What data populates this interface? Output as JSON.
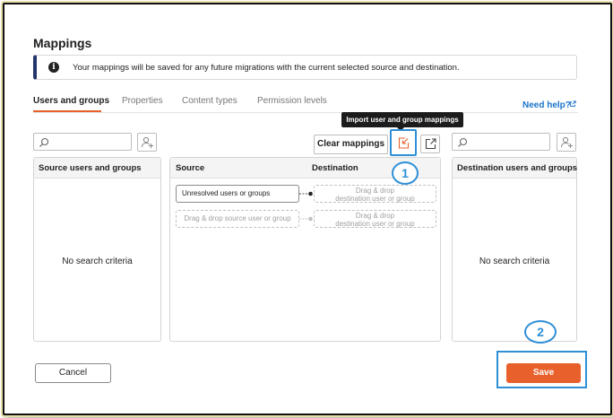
{
  "dialog": {
    "title": "Mappings",
    "info_text": "Your mappings will be saved for any future migrations with the current selected source and destination."
  },
  "tabs": [
    {
      "label": "Users and groups",
      "active": true
    },
    {
      "label": "Properties",
      "active": false
    },
    {
      "label": "Content types",
      "active": false
    },
    {
      "label": "Permission levels",
      "active": false
    }
  ],
  "help_link": "Need help?",
  "toolbar": {
    "clear_mappings_label": "Clear mappings",
    "import_tooltip": "Import user and group mappings"
  },
  "source_panel": {
    "title": "Source users and groups",
    "empty_text": "No search criteria"
  },
  "mapping_panel": {
    "source_header": "Source",
    "destination_header": "Destination",
    "rows": [
      {
        "source": "Unresolved users or groups",
        "source_placeholder": false,
        "destination_line1": "Drag & drop",
        "destination_line2": "destination user or group"
      },
      {
        "source": "Drag & drop source user or group",
        "source_placeholder": true,
        "destination_line1": "Drag & drop",
        "destination_line2": "destination user or group"
      }
    ]
  },
  "destination_panel": {
    "title": "Destination users and groups",
    "empty_text": "No search criteria"
  },
  "footer": {
    "cancel_label": "Cancel",
    "save_label": "Save"
  },
  "callouts": {
    "one": "1",
    "two": "2"
  },
  "colors": {
    "accent_orange": "#e8612c",
    "callout_blue": "#2e8fd6",
    "link_blue": "#1a73c9",
    "banner_navy": "#24356b"
  },
  "icons": [
    "info-icon",
    "search-icon",
    "add-user-icon",
    "import-icon",
    "export-icon",
    "external-link-icon"
  ]
}
